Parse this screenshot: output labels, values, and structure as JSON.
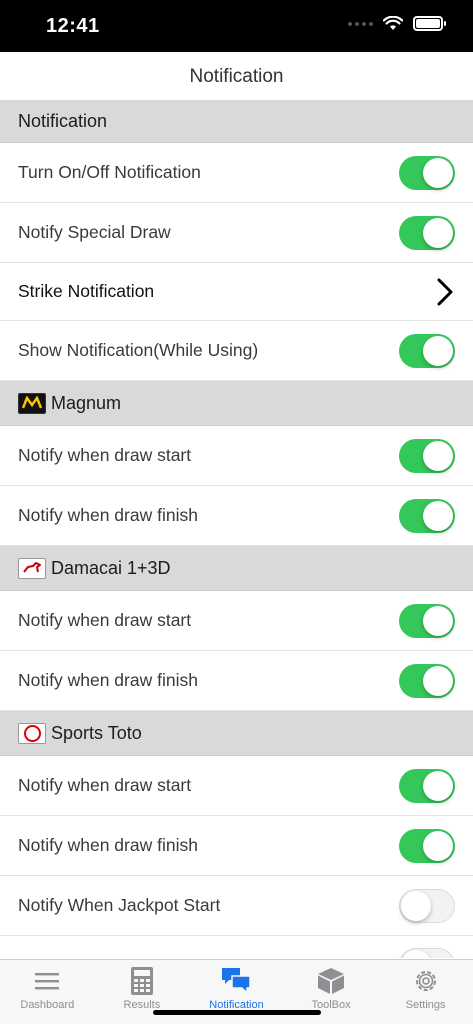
{
  "status_bar": {
    "time": "12:41"
  },
  "nav": {
    "title": "Notification"
  },
  "sections": [
    {
      "header": "Notification",
      "rows": [
        {
          "label": "Turn On/Off Notification",
          "toggle": "on"
        },
        {
          "label": "Notify Special Draw",
          "toggle": "on"
        },
        {
          "label": "Strike Notification",
          "type": "link"
        },
        {
          "label": "Show Notification(While Using)",
          "toggle": "on"
        }
      ]
    },
    {
      "header": "Magnum",
      "logo": "magnum",
      "rows": [
        {
          "label": "Notify when draw start",
          "toggle": "on"
        },
        {
          "label": "Notify when draw finish",
          "toggle": "on"
        }
      ]
    },
    {
      "header": "Damacai 1+3D",
      "logo": "damacai",
      "rows": [
        {
          "label": "Notify when draw start",
          "toggle": "on"
        },
        {
          "label": "Notify when draw finish",
          "toggle": "on"
        }
      ]
    },
    {
      "header": "Sports Toto",
      "logo": "toto",
      "rows": [
        {
          "label": "Notify when draw start",
          "toggle": "on"
        },
        {
          "label": "Notify when draw finish",
          "toggle": "on"
        },
        {
          "label": "Notify When Jackpot Start",
          "toggle": "off"
        }
      ]
    }
  ],
  "tabs": [
    {
      "label": "Dashboard",
      "icon": "list-icon"
    },
    {
      "label": "Results",
      "icon": "calculator-icon"
    },
    {
      "label": "Notification",
      "icon": "chat-bubbles-icon",
      "active": true
    },
    {
      "label": "ToolBox",
      "icon": "cube-icon"
    },
    {
      "label": "Settings",
      "icon": "gear-icon"
    }
  ],
  "colors": {
    "toggle_on": "#34c759",
    "tab_active": "#1a73e8",
    "section_header_bg": "#d9d9d9"
  }
}
